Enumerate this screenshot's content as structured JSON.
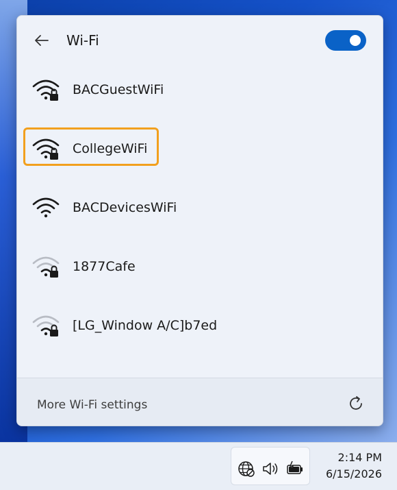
{
  "flyout": {
    "title": "Wi-Fi",
    "toggle_state": "on",
    "networks": [
      {
        "label": "BACGuestWiFi",
        "signal": "strong",
        "secured": true
      },
      {
        "label": "CollegeWiFi",
        "signal": "strong",
        "secured": true,
        "highlighted": true
      },
      {
        "label": "BACDevicesWiFi",
        "signal": "strong",
        "secured": false
      },
      {
        "label": "1877Cafe",
        "signal": "weak",
        "secured": true
      },
      {
        "label": "[LG_Window A/C]b7ed",
        "signal": "weak",
        "secured": true
      }
    ],
    "footer": {
      "more_settings_label": "More Wi-Fi settings"
    }
  },
  "taskbar": {
    "tray_icons": [
      "globe-network-icon",
      "speaker-icon",
      "battery-charging-icon"
    ],
    "clock": {
      "time": "2:14 PM",
      "date": "6/15/2026"
    }
  },
  "colors": {
    "accent": "#0a62c7",
    "highlight": "#f2a01e",
    "panel_bg": "#eef2f9"
  }
}
